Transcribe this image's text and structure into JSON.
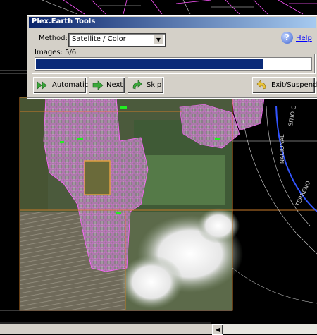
{
  "dialog": {
    "title": "Plex.Earth Tools",
    "method_label": "Method:",
    "method_value": "Satellite / Color",
    "help_label": "Help",
    "images_label": "Images: 5/6",
    "progress_fraction": 0.83,
    "buttons": {
      "automatic": "Automatic",
      "next": "Next",
      "skip": "Skip",
      "exit": "Exit/Suspend"
    }
  },
  "map": {
    "labels": {
      "nacional": "NACIONAL",
      "terreno": "TERRENO",
      "sitio": "SITIO C"
    }
  },
  "colors": {
    "dialog_bg": "#d4d0c8",
    "title_start": "#0a246a",
    "progress_fill": "#0a2a78",
    "cad_bg": "#000000",
    "parcel_lines": "#ff44ff",
    "grid_lines": "#c87a2a"
  }
}
